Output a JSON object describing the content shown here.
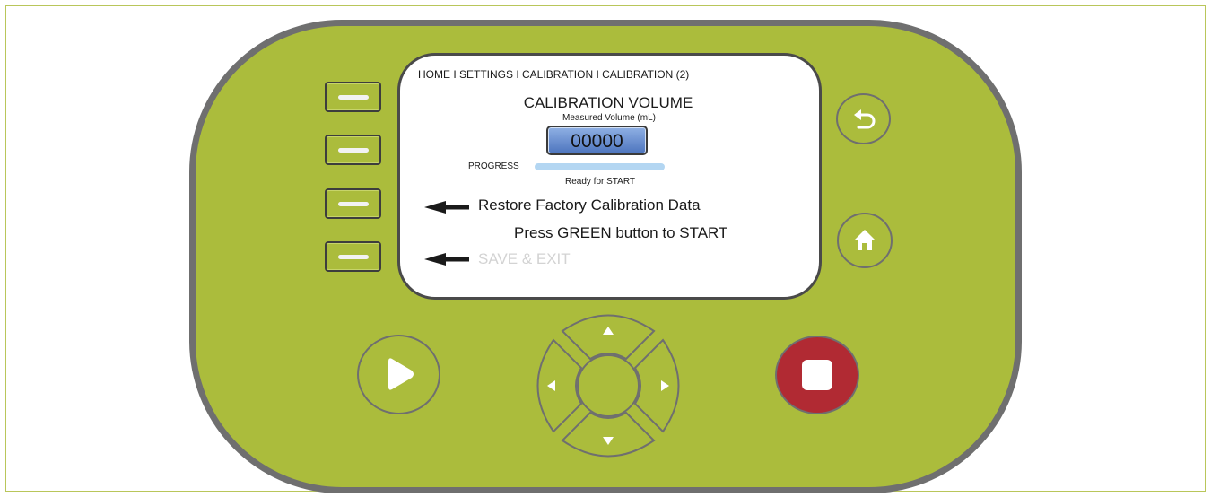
{
  "screen": {
    "breadcrumb": "HOME I SETTINGS I CALIBRATION I CALIBRATION (2)",
    "title": "CALIBRATION VOLUME",
    "volume_label": "Measured Volume (mL)",
    "volume_value": "00000",
    "progress_label": "PROGRESS",
    "progress_fraction": 0,
    "progress_status": "Ready for START",
    "menu_items": [
      {
        "label": "Restore Factory Calibration Data",
        "enabled": true
      },
      {
        "label": "SAVE & EXIT",
        "enabled": false
      }
    ],
    "instruction": "Press GREEN button to START"
  },
  "colors": {
    "body": "#abbc3c",
    "bezel": "#6f6f6f",
    "stop_button": "#b12a33",
    "volume_box": "#5a84c9",
    "progress_bar": "#b3d6f2",
    "disabled_text": "#d3d3d3"
  },
  "icons": {
    "back": "back-arrow-icon",
    "home": "home-icon",
    "play": "play-icon",
    "stop": "stop-icon",
    "up": "triangle-up-icon",
    "down": "triangle-down-icon",
    "left": "triangle-left-icon",
    "right": "triangle-right-icon"
  }
}
